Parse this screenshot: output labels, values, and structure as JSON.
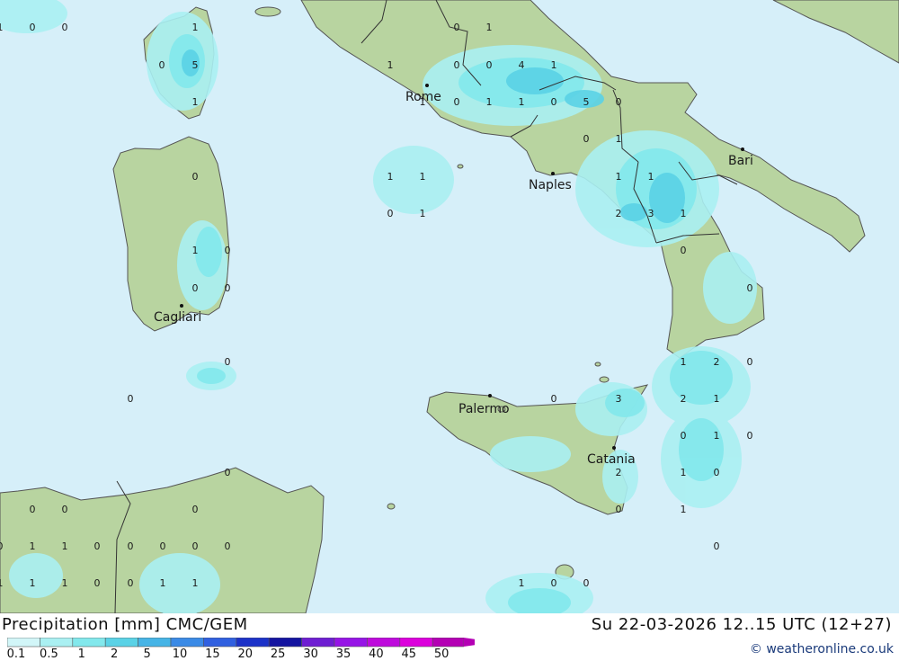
{
  "header": {
    "title": "Precipitation [mm] CMC/GEM",
    "datetime": "Su 22-03-2026 12..15 UTC (12+27)"
  },
  "credit": "© weatheronline.co.uk",
  "colors": {
    "sea": "#d6eff9",
    "land": "#b8d4a0",
    "border": "#333333"
  },
  "legend": {
    "labels": [
      "0.1",
      "0.5",
      "1",
      "2",
      "5",
      "10",
      "15",
      "20",
      "25",
      "30",
      "35",
      "40",
      "45",
      "50"
    ],
    "colors": [
      "#d2f6f8",
      "#aaf0f2",
      "#82e8ec",
      "#5ad2e6",
      "#46b4e6",
      "#3a8ae6",
      "#3060e0",
      "#1c32c8",
      "#1414a0",
      "#6e1ed2",
      "#9614e6",
      "#be0adc",
      "#dc00dc",
      "#b400b4"
    ]
  },
  "cities": [
    {
      "name": "Rome"
    },
    {
      "name": "Naples"
    },
    {
      "name": "Bari"
    },
    {
      "name": "Cagliari"
    },
    {
      "name": "Palermo"
    },
    {
      "name": "Catania"
    }
  ],
  "values": [
    "1",
    "0",
    "0",
    "1",
    "0",
    "5",
    "1",
    "0",
    "1",
    "1",
    "0",
    "0",
    "4",
    "1",
    "1",
    "0",
    "1",
    "1",
    "0",
    "5",
    "0",
    "0",
    "1",
    "1",
    "1",
    "1",
    "0",
    "0",
    "1",
    "1",
    "2",
    "3",
    "1",
    "0",
    "1",
    "0",
    "0",
    "0",
    "0",
    "0",
    "1",
    "2",
    "0",
    "0",
    "0",
    "3",
    "2",
    "1",
    "0",
    "1",
    "0",
    "0",
    "2",
    "1",
    "0",
    "0",
    "1",
    "0",
    "0",
    "0",
    "0",
    "0",
    "1",
    "1",
    "0",
    "0",
    "0",
    "0",
    "0",
    "1",
    "1",
    "1",
    "0",
    "0",
    "1",
    "1",
    "1",
    "0",
    "0"
  ]
}
